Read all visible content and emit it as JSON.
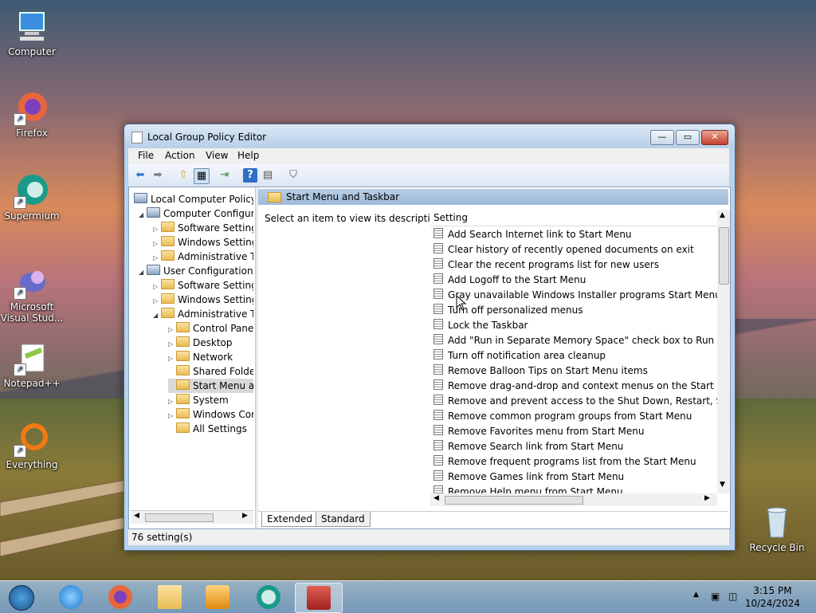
{
  "desktop": {
    "icons": [
      {
        "label": "Computer"
      },
      {
        "label": "Firefox"
      },
      {
        "label": "Supermium"
      },
      {
        "label": "Microsoft Visual Stud..."
      },
      {
        "label": "Notepad++"
      },
      {
        "label": "Everything"
      },
      {
        "label": "Recycle Bin"
      }
    ]
  },
  "window": {
    "title": "Local Group Policy Editor",
    "controls": {
      "minimize": "—",
      "maximize": "▭",
      "close": "✕"
    }
  },
  "menubar": [
    "File",
    "Action",
    "View",
    "Help"
  ],
  "tree": {
    "items": [
      {
        "label": "Local Computer Policy",
        "level": 0
      },
      {
        "label": "Computer Configura",
        "level": 1,
        "expander": "◢"
      },
      {
        "label": "Software Settings",
        "level": 2,
        "expander": "▷"
      },
      {
        "label": "Windows Setting",
        "level": 2,
        "expander": "▷"
      },
      {
        "label": "Administrative Te",
        "level": 2,
        "expander": "▷"
      },
      {
        "label": "User Configuration",
        "level": 1,
        "expander": "◢"
      },
      {
        "label": "Software Settings",
        "level": 2,
        "expander": "▷"
      },
      {
        "label": "Windows Setting",
        "level": 2,
        "expander": "▷"
      },
      {
        "label": "Administrative Te",
        "level": 2,
        "expander": "◢"
      },
      {
        "label": "Control Panel",
        "level": 3,
        "expander": "▷"
      },
      {
        "label": "Desktop",
        "level": 3,
        "expander": "▷"
      },
      {
        "label": "Network",
        "level": 3,
        "expander": "▷"
      },
      {
        "label": "Shared Folder",
        "level": 3,
        "expander": ""
      },
      {
        "label": "Start Menu ar",
        "level": 3,
        "expander": "",
        "selected": true
      },
      {
        "label": "System",
        "level": 3,
        "expander": "▷"
      },
      {
        "label": "Windows Cor",
        "level": 3,
        "expander": "▷"
      },
      {
        "label": "All Settings",
        "level": 3,
        "expander": ""
      }
    ]
  },
  "right": {
    "header": "Start Menu and Taskbar",
    "description": "Select an item to view its description.",
    "column": "Setting",
    "settings": [
      "Add Search Internet link to Start Menu",
      "Clear history of recently opened documents on exit",
      "Clear the recent programs list for new users",
      "Add Logoff to the Start Menu",
      "Gray unavailable Windows Installer programs Start Menu sh...",
      "Turn off personalized menus",
      "Lock the Taskbar",
      "Add \"Run in Separate Memory Space\" check box to Run dial...",
      "Turn off notification area cleanup",
      "Remove Balloon Tips on Start Menu items",
      "Remove drag-and-drop and context menus on the Start Me...",
      "Remove and prevent access to the Shut Down, Restart, Sleep...",
      "Remove common program groups from Start Menu",
      "Remove Favorites menu from Start Menu",
      "Remove Search link from Start Menu",
      "Remove frequent programs list from the Start Menu",
      "Remove Games link from Start Menu",
      "Remove Help menu from Start Menu"
    ]
  },
  "tabs": [
    "Extended",
    "Standard"
  ],
  "status": "76 setting(s)",
  "taskbar": {
    "time": "3:15 PM",
    "date": "10/24/2024",
    "tray_chevron": "▲"
  }
}
